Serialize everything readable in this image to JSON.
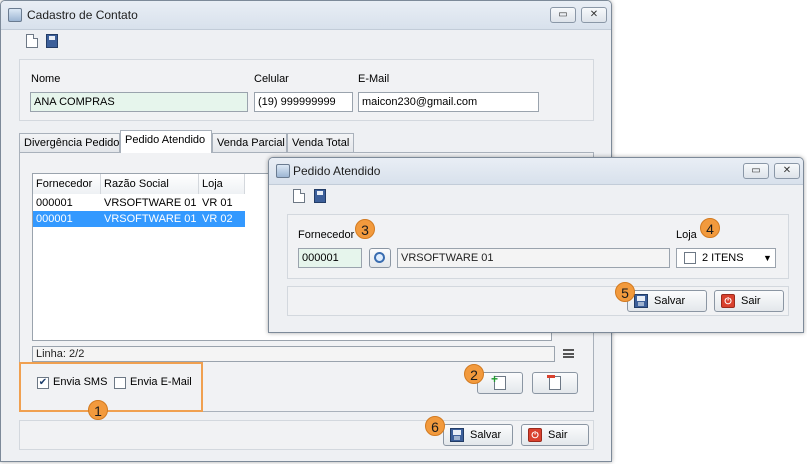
{
  "main_window": {
    "title": "Cadastro de Contato",
    "fields": {
      "nome_label": "Nome",
      "nome_value": "ANA COMPRAS",
      "celular_label": "Celular",
      "celular_value": "(19) 999999999",
      "email_label": "E-Mail",
      "email_value": "maicon230@gmail.com"
    },
    "tabs": [
      {
        "label": "Divergência Pedido"
      },
      {
        "label": "Pedido Atendido"
      },
      {
        "label": "Venda Parcial"
      },
      {
        "label": "Venda Total"
      }
    ],
    "table": {
      "headers": [
        "Fornecedor",
        "Razão Social",
        "Loja"
      ],
      "rows": [
        {
          "fornecedor": "000001",
          "razao_social": "VRSOFTWARE 01",
          "loja": "VR 01"
        },
        {
          "fornecedor": "000001",
          "razao_social": "VRSOFTWARE 01",
          "loja": "VR 02"
        }
      ]
    },
    "status_line": "Linha: 2/2",
    "checkboxes": {
      "envia_sms": "Envia SMS",
      "envia_email": "Envia E-Mail"
    },
    "buttons": {
      "salvar": "Salvar",
      "sair": "Sair"
    }
  },
  "dialog": {
    "title": "Pedido Atendido",
    "fornecedor_label": "Fornecedor",
    "fornecedor_code": "000001",
    "fornecedor_name": "VRSOFTWARE 01",
    "loja_label": "Loja",
    "loja_value": "2 ITENS",
    "buttons": {
      "salvar": "Salvar",
      "sair": "Sair"
    }
  },
  "callouts": [
    "1",
    "2",
    "3",
    "4",
    "5",
    "6"
  ],
  "colors": {
    "callout": "#f29a3d",
    "selection": "#3399ff",
    "name_field": "#e6f5ec",
    "exit": "#d9412e"
  }
}
